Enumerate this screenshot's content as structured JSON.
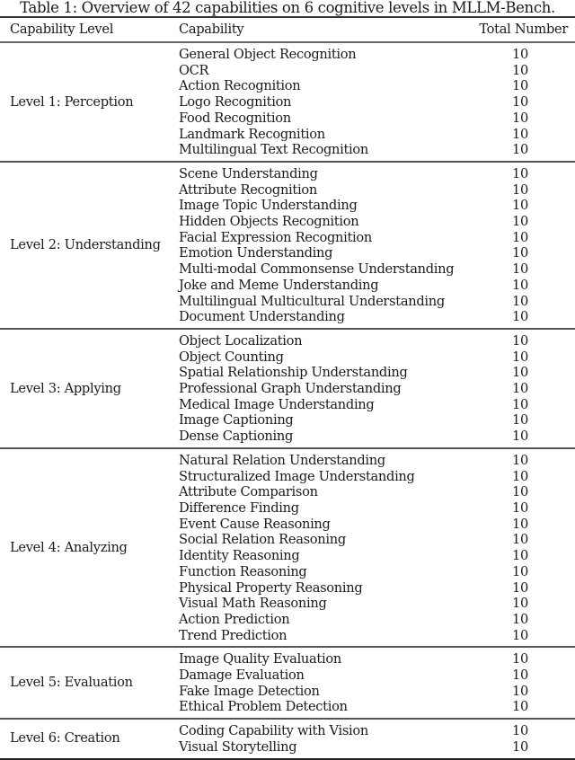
{
  "caption": "Table 1: Overview of 42 capabilities on 6 cognitive levels in MLLM-Bench.",
  "headers": {
    "level": "Capability Level",
    "capability": "Capability",
    "total": "Total Number"
  },
  "groups": [
    {
      "level": "Level 1: Perception",
      "rows": [
        {
          "capability": "General Object Recognition",
          "total": "10"
        },
        {
          "capability": "OCR",
          "total": "10"
        },
        {
          "capability": "Action Recognition",
          "total": "10"
        },
        {
          "capability": "Logo Recognition",
          "total": "10"
        },
        {
          "capability": "Food Recognition",
          "total": "10"
        },
        {
          "capability": "Landmark Recognition",
          "total": "10"
        },
        {
          "capability": "Multilingual Text Recognition",
          "total": "10"
        }
      ]
    },
    {
      "level": "Level 2: Understanding",
      "rows": [
        {
          "capability": "Scene Understanding",
          "total": "10"
        },
        {
          "capability": "Attribute Recognition",
          "total": "10"
        },
        {
          "capability": "Image Topic Understanding",
          "total": "10"
        },
        {
          "capability": "Hidden Objects Recognition",
          "total": "10"
        },
        {
          "capability": "Facial Expression Recognition",
          "total": "10"
        },
        {
          "capability": "Emotion Understanding",
          "total": "10"
        },
        {
          "capability": "Multi-modal Commonsense Understanding",
          "total": "10"
        },
        {
          "capability": "Joke and Meme Understanding",
          "total": "10"
        },
        {
          "capability": "Multilingual Multicultural Understanding",
          "total": "10"
        },
        {
          "capability": "Document Understanding",
          "total": "10"
        }
      ]
    },
    {
      "level": "Level 3: Applying",
      "rows": [
        {
          "capability": "Object Localization",
          "total": "10"
        },
        {
          "capability": "Object Counting",
          "total": "10"
        },
        {
          "capability": "Spatial Relationship Understanding",
          "total": "10"
        },
        {
          "capability": "Professional Graph Understanding",
          "total": "10"
        },
        {
          "capability": "Medical Image Understanding",
          "total": "10"
        },
        {
          "capability": "Image Captioning",
          "total": "10"
        },
        {
          "capability": "Dense Captioning",
          "total": "10"
        }
      ]
    },
    {
      "level": "Level 4: Analyzing",
      "rows": [
        {
          "capability": "Natural Relation Understanding",
          "total": "10"
        },
        {
          "capability": "Structuralized Image Understanding",
          "total": "10"
        },
        {
          "capability": "Attribute Comparison",
          "total": "10"
        },
        {
          "capability": "Difference Finding",
          "total": "10"
        },
        {
          "capability": "Event Cause Reasoning",
          "total": "10"
        },
        {
          "capability": "Social Relation Reasoning",
          "total": "10"
        },
        {
          "capability": "Identity Reasoning",
          "total": "10"
        },
        {
          "capability": "Function Reasoning",
          "total": "10"
        },
        {
          "capability": "Physical Property Reasoning",
          "total": "10"
        },
        {
          "capability": "Visual Math Reasoning",
          "total": "10"
        },
        {
          "capability": "Action Prediction",
          "total": "10"
        },
        {
          "capability": "Trend Prediction",
          "total": "10"
        }
      ]
    },
    {
      "level": "Level 5: Evaluation",
      "rows": [
        {
          "capability": "Image Quality Evaluation",
          "total": "10"
        },
        {
          "capability": "Damage Evaluation",
          "total": "10"
        },
        {
          "capability": "Fake Image Detection",
          "total": "10"
        },
        {
          "capability": "Ethical Problem Detection",
          "total": "10"
        }
      ]
    },
    {
      "level": "Level 6: Creation",
      "rows": [
        {
          "capability": "Coding Capability with Vision",
          "total": "10"
        },
        {
          "capability": "Visual Storytelling",
          "total": "10"
        }
      ]
    }
  ]
}
